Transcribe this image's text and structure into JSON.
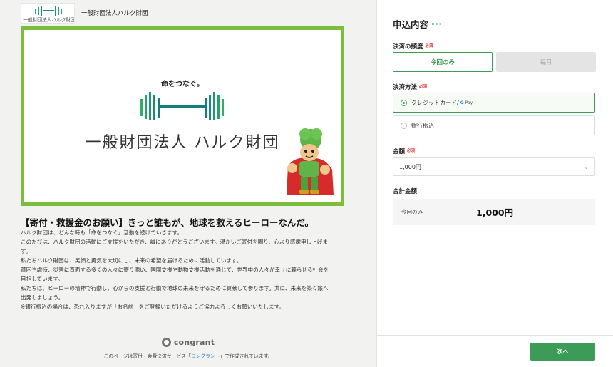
{
  "header": {
    "logo_text": "一般財団法人ハルク財団",
    "org_name": "一般財団法人ハルク財団"
  },
  "hero": {
    "tagline": "命をつなぐ。",
    "org_logotype": "一般財団法人 ハルク財団"
  },
  "content": {
    "headline": "【寄付・救援金のお願い】きっと誰もが、地球を救えるヒーローなんだ。",
    "paragraphs": [
      "ハルク財団は、どんな時も「命をつなぐ」活動を続けていきます。",
      "このたびは、ハルク財団の活動にご支援をいただき、誠にありがとうございます。温かいご寄付を賜り、心より感謝申し上げま",
      "す。",
      "私たちハルク財団は、笑顔と勇気を大切にし、未来の希望を届けるために活動しています。",
      "貧困や虐待、災害に直面する多くの人々に寄り添い、国際支援や動物支援活動を通じて、世界中の人々が幸せに暮らせる社会を",
      "目指しています。",
      "私たちは、ヒーローの精神で行動し、心からの支援と行動で地球の未来を守るために貢献して参ります。共に、未来を築く旅へ",
      "出発しましょう。",
      "※銀行振込の場合は、恐れ入りますが「お名前」をご登録いただけるようご協力よろしくお願いいたします。"
    ]
  },
  "footer": {
    "brand": "congrant",
    "note_before": "このページは寄付・会費決済サービス「",
    "note_link": "コングラント",
    "note_after": "」で作成されています。"
  },
  "form": {
    "title": "申込内容",
    "required_mark": "必須",
    "frequency": {
      "label": "決済の頻度",
      "options": [
        "今回のみ",
        "毎月"
      ],
      "selected": "今回のみ"
    },
    "payment_method": {
      "label": "決済方法",
      "options": [
        {
          "label": "クレジットカード",
          "suffix": " / ",
          "gpay_g": "G",
          "gpay_text": " Pay",
          "selected": true
        },
        {
          "label": "銀行振込",
          "selected": false
        }
      ]
    },
    "amount": {
      "label": "金額",
      "value": "1,000円"
    },
    "total": {
      "label": "合計金額",
      "row_label": "今回のみ",
      "row_value": "1,000円"
    },
    "next_button": "次へ"
  },
  "colors": {
    "brand_green": "#3d9a55",
    "hero_border": "#7cbe3b",
    "required_red": "#e03030",
    "link_blue": "#2a7ed8"
  }
}
